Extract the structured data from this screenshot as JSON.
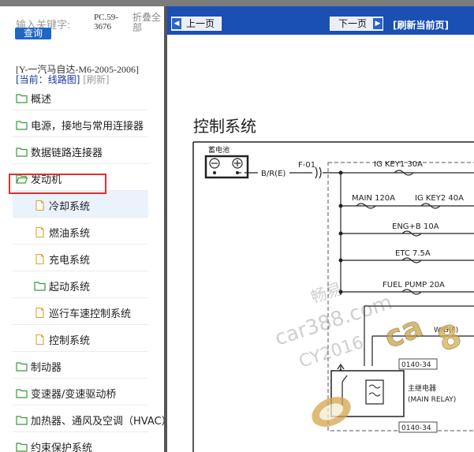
{
  "sidebar": {
    "search_label": "输入关键字:",
    "query_button": "查询",
    "model_code": "PC.59-3676",
    "fold_all": "折叠全部",
    "car_title": "[Y-一汽马自达-M6-2005-2006]",
    "current_prefix": "[当前：",
    "current_value": "线路图",
    "current_suffix": "]",
    "refresh_link": "[刷新]",
    "items": [
      {
        "label": "概述",
        "level": 1,
        "icon": "folder-icon"
      },
      {
        "label": "电源，接地与常用连接器",
        "level": 1,
        "icon": "folder-icon"
      },
      {
        "label": "数据链路连接器",
        "level": 1,
        "icon": "folder-icon"
      },
      {
        "label": "发动机",
        "level": 1,
        "icon": "folder-open-icon",
        "highlighted": true
      },
      {
        "label": "冷却系统",
        "level": 2,
        "icon": "page-icon",
        "selected": true
      },
      {
        "label": "燃油系统",
        "level": 2,
        "icon": "page-icon"
      },
      {
        "label": "充电系统",
        "level": 2,
        "icon": "page-icon"
      },
      {
        "label": "起动系统",
        "level": 2,
        "icon": "folder-icon"
      },
      {
        "label": "巡行车速控制系统",
        "level": 2,
        "icon": "page-icon"
      },
      {
        "label": "控制系统",
        "level": 2,
        "icon": "page-icon"
      },
      {
        "label": "制动器",
        "level": 1,
        "icon": "folder-icon"
      },
      {
        "label": "变速器/变速驱动桥",
        "level": 1,
        "icon": "folder-icon"
      },
      {
        "label": "加热器、通风及空调（HVAC）",
        "level": 1,
        "icon": "folder-icon"
      },
      {
        "label": "约束保护系统",
        "level": 1,
        "icon": "folder-icon"
      }
    ]
  },
  "toolbar": {
    "prev_label": "上一页",
    "next_label": "下一页",
    "refresh_current": "[刷新当前页]",
    "accent": "#1a4fb4"
  },
  "diagram": {
    "title": "控制系统",
    "battery_label": "蓄电池",
    "wire_label": "B/R(E)",
    "connector_label": "F-01",
    "fuses": {
      "ig_key1": "IG KEY1 30A",
      "main": "MAIN 120A",
      "ig_key2": "IG KEY2 40A",
      "eng_b": "ENG+B 10A",
      "etc": "ETC 7.5A",
      "fuel_pump": "FUEL PUMP 20A"
    },
    "wg_label": "W/G(F)",
    "conn_top": "0140-34",
    "conn_bottom": "0140-34",
    "relay_cn": "主继电器",
    "relay_en": "(MAIN RELAY)",
    "watermark_1": "畅易",
    "watermark_2": "car388.com",
    "watermark_3": "CY2016"
  }
}
